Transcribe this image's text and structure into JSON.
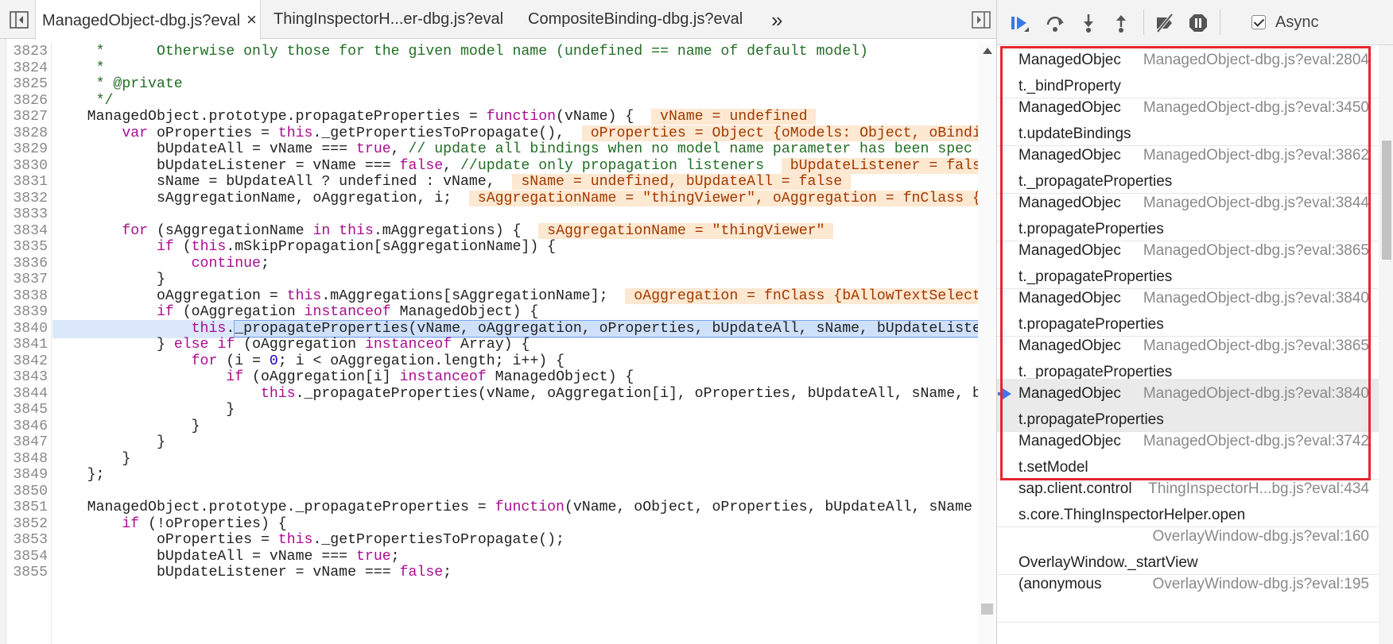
{
  "editor": {
    "tabs": [
      {
        "label": "ManagedObject-dbg.js?eval",
        "active": true
      },
      {
        "label": "ThingInspectorH...er-dbg.js?eval",
        "active": false
      },
      {
        "label": "CompositeBinding-dbg.js?eval",
        "active": false
      }
    ],
    "close_glyph": "×",
    "more_tabs_glyph": "»",
    "current_line": 3840,
    "lines": [
      {
        "n": "3823",
        "html": "<span class=\"cm\">     *      Otherwise only those for the given model name (undefined == name of default model)</span>"
      },
      {
        "n": "3824",
        "html": "<span class=\"cm\">     *</span>"
      },
      {
        "n": "3825",
        "html": "<span class=\"cm\">     * @private</span>"
      },
      {
        "n": "3826",
        "html": "<span class=\"cm\">     */</span>"
      },
      {
        "n": "3827",
        "html": "    ManagedObject.prototype.propagateProperties = <span class=\"kw\">function</span>(vName) {  <span class=\"ann\"> vName = undefined </span>"
      },
      {
        "n": "3828",
        "html": "        <span class=\"kw\">var</span> oProperties = <span class=\"kw\">this</span>._getPropertiesToPropagate(),  <span class=\"ann\"> oProperties = Object {oModels: Object, oBindi</span>"
      },
      {
        "n": "3829",
        "html": "            bUpdateAll = vName === <span class=\"kw\">true</span>, <span class=\"cm\">// update all bindings when no model name parameter has been spec</span>"
      },
      {
        "n": "3830",
        "html": "            bUpdateListener = vName === <span class=\"kw\">false</span>, <span class=\"cm\">//update only propagation listeners</span>  <span class=\"ann\"> bUpdateListener = fals</span>"
      },
      {
        "n": "3831",
        "html": "            sName = bUpdateAll ? undefined : vName,  <span class=\"ann\"> sName = undefined, bUpdateAll = false </span>"
      },
      {
        "n": "3832",
        "html": "            sAggregationName, oAggregation, i;  <span class=\"ann\"> sAggregationName = \"thingViewer\", oAggregation = fnClass {</span>"
      },
      {
        "n": "3833",
        "html": ""
      },
      {
        "n": "3834",
        "html": "        <span class=\"kw\">for</span> (sAggregationName <span class=\"kw\">in</span> <span class=\"kw\">this</span>.mAggregations) {  <span class=\"ann\"> sAggregationName = \"thingViewer\" </span>"
      },
      {
        "n": "3835",
        "html": "            <span class=\"kw\">if</span> (<span class=\"kw\">this</span>.mSkipPropagation[sAggregationName]) {"
      },
      {
        "n": "3836",
        "html": "                <span class=\"kw\">continue</span>;"
      },
      {
        "n": "3837",
        "html": "            }"
      },
      {
        "n": "3838",
        "html": "            oAggregation = <span class=\"kw\">this</span>.mAggregations[sAggregationName];  <span class=\"ann\"> oAggregation = fnClass {bAllowTextSelect</span>"
      },
      {
        "n": "3839",
        "html": "            <span class=\"kw\">if</span> (oAggregation <span class=\"kw\">instanceof</span> ManagedObject) {"
      },
      {
        "n": "3840",
        "html": "                <span class=\"kw\">this</span>.<span class=\"txt\">_propagateProperties(vName, oAggregation, oProperties, bUpdateAll, sName, bUpdateListe</span>"
      },
      {
        "n": "3841",
        "html": "            } <span class=\"kw\">else</span> <span class=\"kw\">if</span> (oAggregation <span class=\"kw\">instanceof</span> Array) {"
      },
      {
        "n": "3842",
        "html": "                <span class=\"kw\">for</span> (i = <span class=\"num\">0</span>; i &lt; oAggregation.length; i++) {"
      },
      {
        "n": "3843",
        "html": "                    <span class=\"kw\">if</span> (oAggregation[i] <span class=\"kw\">instanceof</span> ManagedObject) {"
      },
      {
        "n": "3844",
        "html": "                        <span class=\"kw\">this</span>._propagateProperties(vName, oAggregation[i], oProperties, bUpdateAll, sName, b"
      },
      {
        "n": "3845",
        "html": "                    }"
      },
      {
        "n": "3846",
        "html": "                }"
      },
      {
        "n": "3847",
        "html": "            }"
      },
      {
        "n": "3848",
        "html": "        }"
      },
      {
        "n": "3849",
        "html": "    };"
      },
      {
        "n": "3850",
        "html": ""
      },
      {
        "n": "3851",
        "html": "    ManagedObject.prototype._propagateProperties = <span class=\"kw\">function</span>(vName, oObject, oProperties, bUpdateAll, sName"
      },
      {
        "n": "3852",
        "html": "        <span class=\"kw\">if</span> (!oProperties) {"
      },
      {
        "n": "3853",
        "html": "            oProperties = <span class=\"kw\">this</span>._getPropertiesToPropagate();"
      },
      {
        "n": "3854",
        "html": "            bUpdateAll = vName === <span class=\"kw\">true</span>;"
      },
      {
        "n": "3855",
        "html": "            bUpdateListener = vName === <span class=\"kw\">false</span>;"
      }
    ]
  },
  "debugger": {
    "async_label": "Async",
    "async_checked": true,
    "frames": [
      {
        "name": "ManagedObjec",
        "location": "ManagedObject-dbg.js?eval:2804",
        "sub": "t._bindProperty",
        "selected": false
      },
      {
        "name": "ManagedObjec",
        "location": "ManagedObject-dbg.js?eval:3450",
        "sub": "t.updateBindings",
        "selected": false
      },
      {
        "name": "ManagedObjec",
        "location": "ManagedObject-dbg.js?eval:3862",
        "sub": "t._propagateProperties",
        "selected": false
      },
      {
        "name": "ManagedObjec",
        "location": "ManagedObject-dbg.js?eval:3844",
        "sub": "t.propagateProperties",
        "selected": false
      },
      {
        "name": "ManagedObjec",
        "location": "ManagedObject-dbg.js?eval:3865",
        "sub": "t._propagateProperties",
        "selected": false
      },
      {
        "name": "ManagedObjec",
        "location": "ManagedObject-dbg.js?eval:3840",
        "sub": "t.propagateProperties",
        "selected": false
      },
      {
        "name": "ManagedObjec",
        "location": "ManagedObject-dbg.js?eval:3865",
        "sub": "t._propagateProperties",
        "selected": false
      },
      {
        "name": "ManagedObjec",
        "location": "ManagedObject-dbg.js?eval:3840",
        "sub": "t.propagateProperties",
        "selected": true
      },
      {
        "name": "ManagedObjec",
        "location": "ManagedObject-dbg.js?eval:3742",
        "sub": "t.setModel",
        "selected": false
      },
      {
        "name": "sap.client.control",
        "location": "ThingInspectorH...bg.js?eval:434",
        "sub": "s.core.ThingInspectorHelper.open",
        "selected": false
      },
      {
        "name": "",
        "location": "OverlayWindow-dbg.js?eval:160",
        "sub": "OverlayWindow._startView",
        "selected": false
      },
      {
        "name": "(anonymous",
        "location": "OverlayWindow-dbg.js?eval:195",
        "sub": "",
        "selected": false
      }
    ]
  },
  "colors": {
    "highlight_border": "#e5262b",
    "selected_arrow": "#3b78e7",
    "current_line_bg": "#cfe0fb"
  }
}
